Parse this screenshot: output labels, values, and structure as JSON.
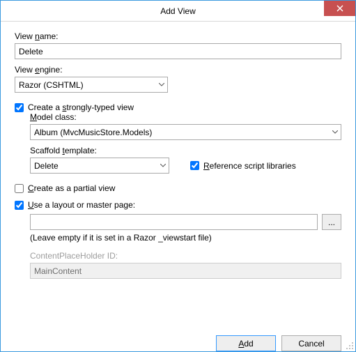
{
  "title": "Add View",
  "viewName": {
    "label": "View name:",
    "underline": "n",
    "value": "Delete"
  },
  "viewEngine": {
    "label": "View engine:",
    "underline": "e",
    "value": "Razor (CSHTML)"
  },
  "strongly": {
    "label": "Create a strongly-typed view",
    "underline": "s",
    "checked": true
  },
  "modelClass": {
    "label": "Model class:",
    "underline": "M",
    "value": "Album (MvcMusicStore.Models)"
  },
  "scaffold": {
    "label": "Scaffold template:",
    "underline": "t",
    "value": "Delete"
  },
  "refScripts": {
    "label": "Reference script libraries",
    "underline": "R",
    "checked": true
  },
  "partial": {
    "label": "Create as a partial view",
    "underline": "C",
    "checked": false
  },
  "useLayout": {
    "label": "Use a layout or master page:",
    "underline": "U",
    "checked": true
  },
  "layoutPath": {
    "value": ""
  },
  "layoutHint": "(Leave empty if it is set in a Razor _viewstart file)",
  "cph": {
    "label": "ContentPlaceHolder ID:",
    "value": "MainContent"
  },
  "browse": "...",
  "buttons": {
    "add": "Add",
    "addUnderline": "A",
    "cancel": "Cancel"
  }
}
